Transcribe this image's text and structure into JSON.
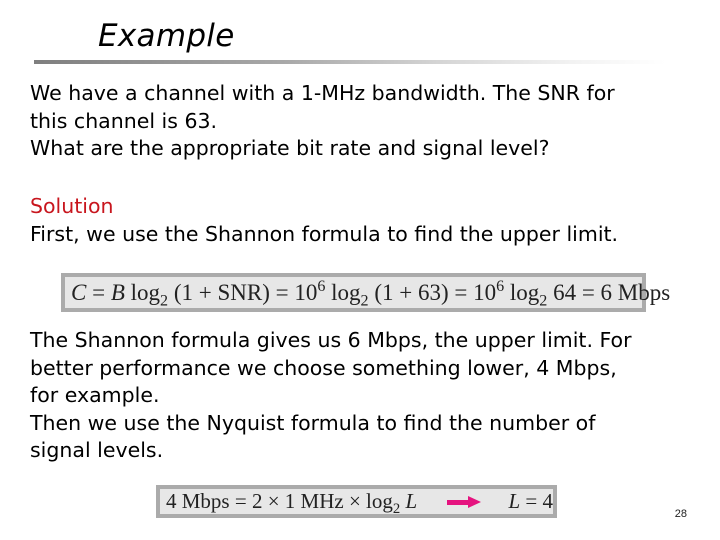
{
  "slide": {
    "title": "Example",
    "page_number": "28",
    "accent_color": "#c8161e",
    "arrow_color": "#e5137f"
  },
  "problem": {
    "lines": [
      "We have a channel with a 1-MHz bandwidth. The SNR for",
      "this channel is 63.",
      "What are the appropriate bit rate and signal level?"
    ]
  },
  "solution": {
    "heading": "Solution",
    "intro": "First, we use the Shannon formula to find the upper limit.",
    "shannon_formula": {
      "lhs": "C",
      "eq1": " = ",
      "b": "B",
      "log1": " log",
      "base1": "2",
      "arg1": " (1 + SNR) = 10",
      "exp1": "6",
      "log2": " log",
      "base2": "2",
      "arg2": " (1 + 63) = 10",
      "exp2": "6",
      "log3": " log",
      "base3": "2",
      "result": " 64 = 6 Mbps"
    },
    "explanation_lines": [
      "The Shannon formula gives us 6 Mbps, the upper limit. For",
      "better performance we choose something lower, 4 Mbps,",
      "for example.",
      "Then we use the Nyquist formula to find the number of",
      "signal levels."
    ],
    "nyquist_formula": {
      "lhs": "4 Mbps = 2 × 1 MHz × log",
      "base": "2",
      "var": "L",
      "arrow": "right-arrow",
      "result_var": "L",
      "result": " = 4"
    }
  }
}
